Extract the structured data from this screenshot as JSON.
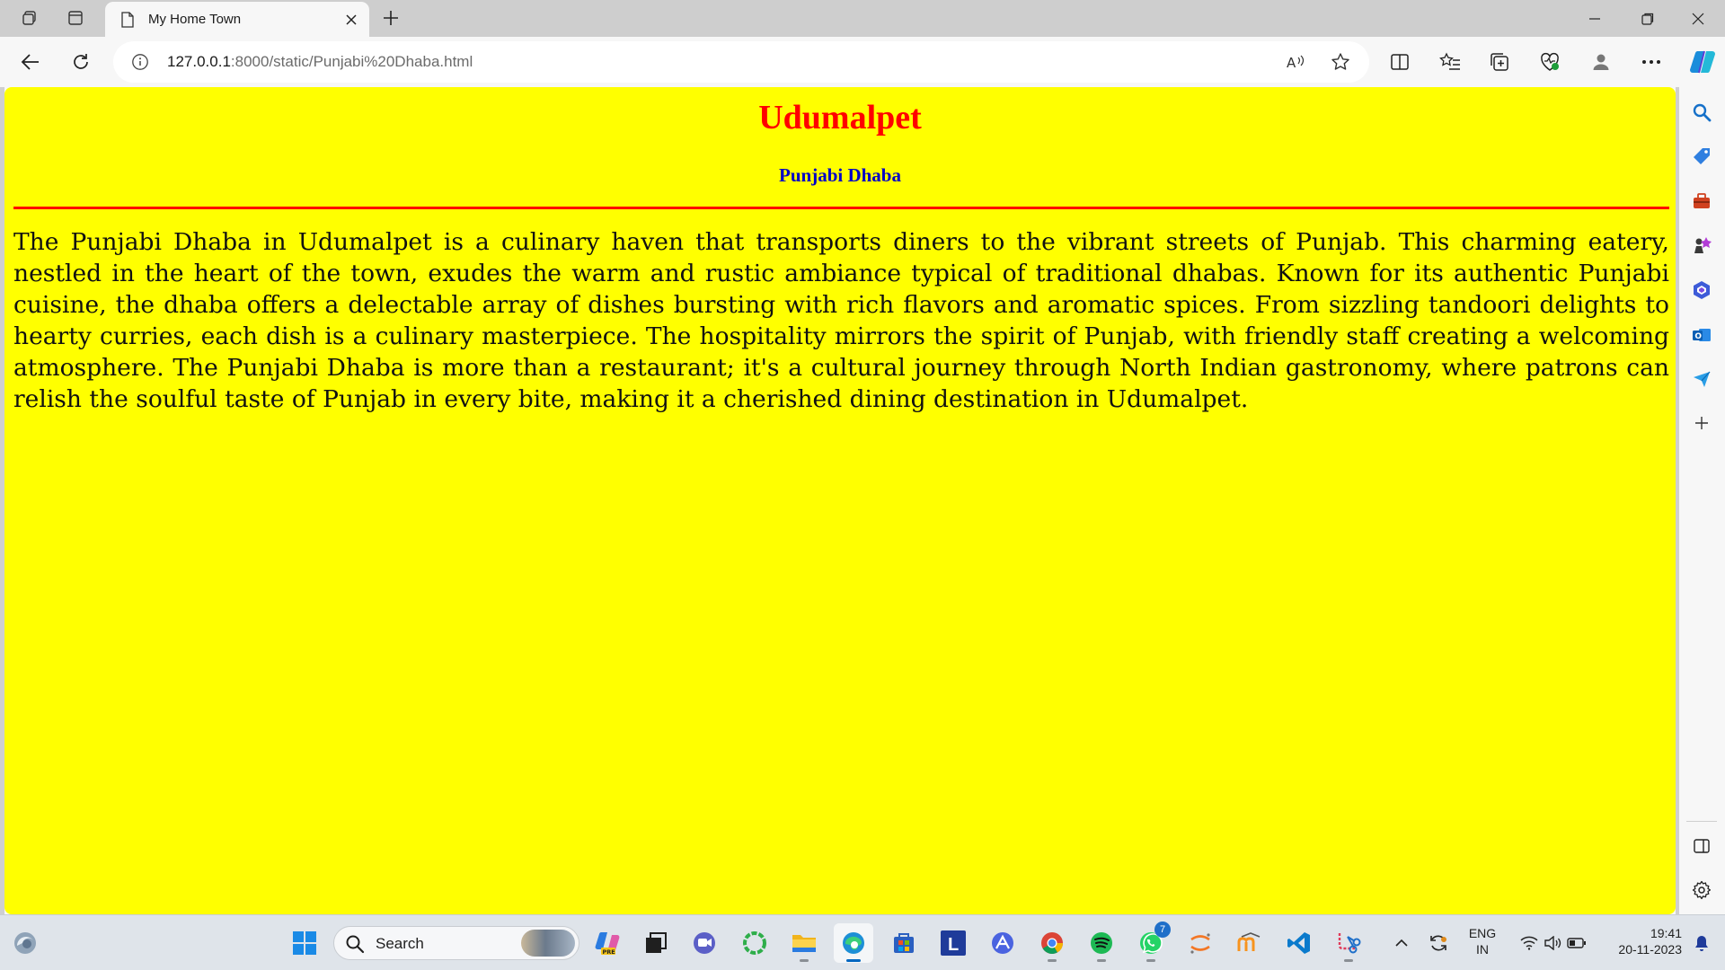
{
  "browser": {
    "tab_title": "My Home Town",
    "url_host": "127.0.0.1",
    "url_rest": ":8000/static/Punjabi%20Dhaba.html"
  },
  "page": {
    "title": "Udumalpet",
    "subtitle": "Punjabi Dhaba",
    "body": "The Punjabi Dhaba in Udumalpet is a culinary haven that transports diners to the vibrant streets of Punjab. This charming eatery, nestled in the heart of the town, exudes the warm and rustic ambiance typical of traditional dhabas. Known for its authentic Punjabi cuisine, the dhaba offers a delectable array of dishes bursting with rich flavors and aromatic spices. From sizzling tandoori delights to hearty curries, each dish is a culinary masterpiece. The hospitality mirrors the spirit of Punjab, with friendly staff creating a welcoming atmosphere. The Punjabi Dhaba is more than a restaurant; it's a cultural journey through North Indian gastronomy, where patrons can relish the soulful taste of Punjab in every bite, making it a cherished dining destination in Udumalpet.",
    "colors": {
      "background": "#ffff00",
      "title": "#ff0000",
      "subtitle": "#0000c8",
      "rule": "#ff0000"
    }
  },
  "taskbar": {
    "search_label": "Search",
    "whatsapp_badge": "7",
    "language_line1": "ENG",
    "language_line2": "IN",
    "time": "19:41",
    "date": "20-11-2023",
    "pinned_apps": [
      "copilot-icon",
      "file-manager-icon",
      "teams-icon",
      "circle-app-icon",
      "file-explorer-icon",
      "edge-icon",
      "store-icon",
      "l-app-icon",
      "arc-icon",
      "chrome-icon",
      "spotify-icon",
      "whatsapp-icon",
      "jupyter-icon",
      "moodle-icon",
      "vscode-icon",
      "snipping-tool-icon"
    ]
  }
}
